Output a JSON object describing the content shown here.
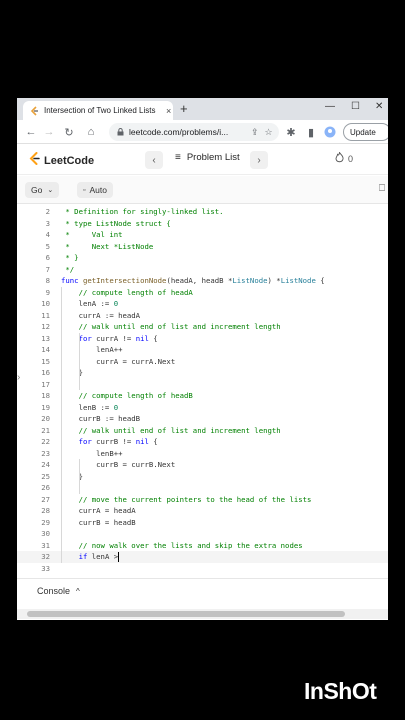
{
  "browser": {
    "tab_title": "Intersection of Two Linked Lists",
    "tab_close": "×",
    "new_tab": "+",
    "url": "leetcode.com/problems/i...",
    "update_label": "Update",
    "window_minimize": "—",
    "window_maximize": "☐",
    "window_close": "✕"
  },
  "leetcode": {
    "logo_text": "LeetCode",
    "prev": "‹",
    "next": "›",
    "problem_list_label": "Problem List",
    "streak_count": "0"
  },
  "editor": {
    "language": "Go",
    "mode": "Auto"
  },
  "code_lines": [
    {
      "ln": "2",
      "parts": [
        [
          "c",
          " * Definition for singly-linked list."
        ]
      ]
    },
    {
      "ln": "3",
      "parts": [
        [
          "c",
          " * type ListNode struct {"
        ]
      ]
    },
    {
      "ln": "4",
      "parts": [
        [
          "c",
          " *     Val int"
        ]
      ]
    },
    {
      "ln": "5",
      "parts": [
        [
          "c",
          " *     Next *ListNode"
        ]
      ]
    },
    {
      "ln": "6",
      "parts": [
        [
          "c",
          " * }"
        ]
      ]
    },
    {
      "ln": "7",
      "parts": [
        [
          "c",
          " */"
        ]
      ]
    },
    {
      "ln": "8",
      "parts": [
        [
          "k",
          "func "
        ],
        [
          "f",
          "getIntersectionNode"
        ],
        [
          "p",
          "(headA, headB *"
        ],
        [
          "t",
          "ListNode"
        ],
        [
          "p",
          ") *"
        ],
        [
          "t",
          "ListNode"
        ],
        [
          "p",
          " {"
        ]
      ]
    },
    {
      "ln": "9",
      "parts": [
        [
          "p",
          "    "
        ],
        [
          "c",
          "// compute length of headA"
        ]
      ]
    },
    {
      "ln": "10",
      "parts": [
        [
          "p",
          "    lenA := "
        ],
        [
          "n",
          "0"
        ]
      ]
    },
    {
      "ln": "11",
      "parts": [
        [
          "p",
          "    currA := headA"
        ]
      ]
    },
    {
      "ln": "12",
      "parts": [
        [
          "p",
          "    "
        ],
        [
          "c",
          "// walk until end of list and increment length"
        ]
      ]
    },
    {
      "ln": "13",
      "parts": [
        [
          "p",
          "    "
        ],
        [
          "k",
          "for"
        ],
        [
          "p",
          " currA != "
        ],
        [
          "k",
          "nil"
        ],
        [
          "p",
          " {"
        ]
      ]
    },
    {
      "ln": "14",
      "parts": [
        [
          "p",
          "        lenA++"
        ]
      ]
    },
    {
      "ln": "15",
      "parts": [
        [
          "p",
          "        currA = currA.Next"
        ]
      ]
    },
    {
      "ln": "16",
      "parts": [
        [
          "p",
          "    }"
        ]
      ]
    },
    {
      "ln": "17",
      "parts": [
        [
          "p",
          ""
        ]
      ]
    },
    {
      "ln": "18",
      "parts": [
        [
          "p",
          "    "
        ],
        [
          "c",
          "// compute length of headB"
        ]
      ]
    },
    {
      "ln": "19",
      "parts": [
        [
          "p",
          "    lenB := "
        ],
        [
          "n",
          "0"
        ]
      ]
    },
    {
      "ln": "20",
      "parts": [
        [
          "p",
          "    currB := headB"
        ]
      ]
    },
    {
      "ln": "21",
      "parts": [
        [
          "p",
          "    "
        ],
        [
          "c",
          "// walk until end of list and increment length"
        ]
      ]
    },
    {
      "ln": "22",
      "parts": [
        [
          "p",
          "    "
        ],
        [
          "k",
          "for"
        ],
        [
          "p",
          " currB != "
        ],
        [
          "k",
          "nil"
        ],
        [
          "p",
          " {"
        ]
      ]
    },
    {
      "ln": "23",
      "parts": [
        [
          "p",
          "        lenB++"
        ]
      ]
    },
    {
      "ln": "24",
      "parts": [
        [
          "p",
          "        currB = currB.Next"
        ]
      ]
    },
    {
      "ln": "25",
      "parts": [
        [
          "p",
          "    }"
        ]
      ]
    },
    {
      "ln": "26",
      "parts": [
        [
          "p",
          ""
        ]
      ]
    },
    {
      "ln": "27",
      "parts": [
        [
          "p",
          "    "
        ],
        [
          "c",
          "// move the current pointers to the head of the lists"
        ]
      ]
    },
    {
      "ln": "28",
      "parts": [
        [
          "p",
          "    currA = headA"
        ]
      ]
    },
    {
      "ln": "29",
      "parts": [
        [
          "p",
          "    currB = headB"
        ]
      ]
    },
    {
      "ln": "30",
      "parts": [
        [
          "p",
          ""
        ]
      ]
    },
    {
      "ln": "31",
      "parts": [
        [
          "p",
          "    "
        ],
        [
          "c",
          "// now walk over the lists and skip the extra nodes"
        ]
      ]
    },
    {
      "ln": "32",
      "parts": [
        [
          "p",
          "    "
        ],
        [
          "k",
          "if"
        ],
        [
          "p",
          " lenA >"
        ]
      ],
      "current": true
    },
    {
      "ln": "33",
      "parts": [
        [
          "p",
          ""
        ]
      ]
    }
  ],
  "console": {
    "label": "Console",
    "toggle": "^"
  },
  "watermark": "InShOt"
}
